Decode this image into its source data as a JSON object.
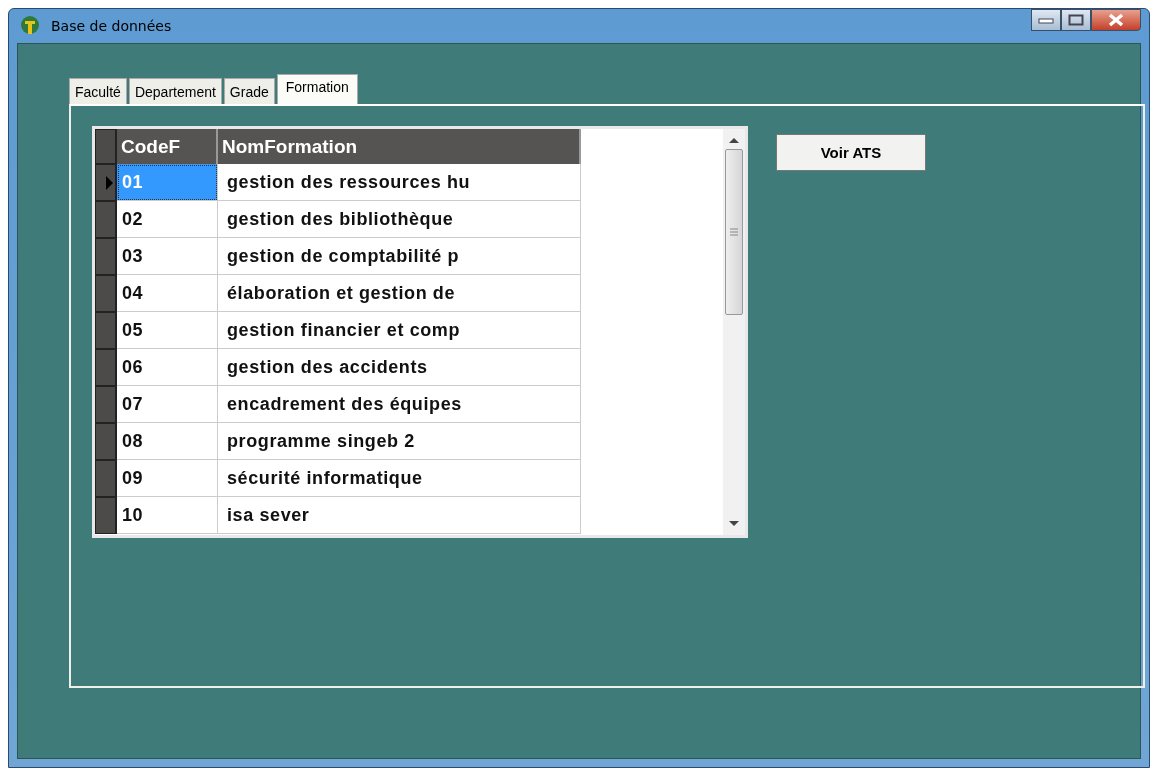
{
  "window": {
    "title": "Base de données"
  },
  "tabs": [
    {
      "label": "Faculté",
      "selected": false
    },
    {
      "label": "Departement",
      "selected": false
    },
    {
      "label": "Grade",
      "selected": false
    },
    {
      "label": "Formation",
      "selected": true
    }
  ],
  "grid": {
    "columns": [
      "CodeF",
      "NomFormation"
    ],
    "rows": [
      {
        "code": "01",
        "name": "gestion des ressources hu",
        "selected": true
      },
      {
        "code": "02",
        "name": "gestion des bibliothèque",
        "selected": false
      },
      {
        "code": "03",
        "name": "gestion de comptabilité p",
        "selected": false
      },
      {
        "code": "04",
        "name": "élaboration et gestion de",
        "selected": false
      },
      {
        "code": "05",
        "name": "gestion financier et comp",
        "selected": false
      },
      {
        "code": "06",
        "name": "gestion des accidents",
        "selected": false
      },
      {
        "code": "07",
        "name": "encadrement des équipes",
        "selected": false
      },
      {
        "code": "08",
        "name": "programme singeb 2",
        "selected": false
      },
      {
        "code": "09",
        "name": "sécurité informatique",
        "selected": false
      },
      {
        "code": "10",
        "name": "isa sever",
        "selected": false
      }
    ]
  },
  "buttons": [
    {
      "label": "Voir ATS"
    }
  ]
}
